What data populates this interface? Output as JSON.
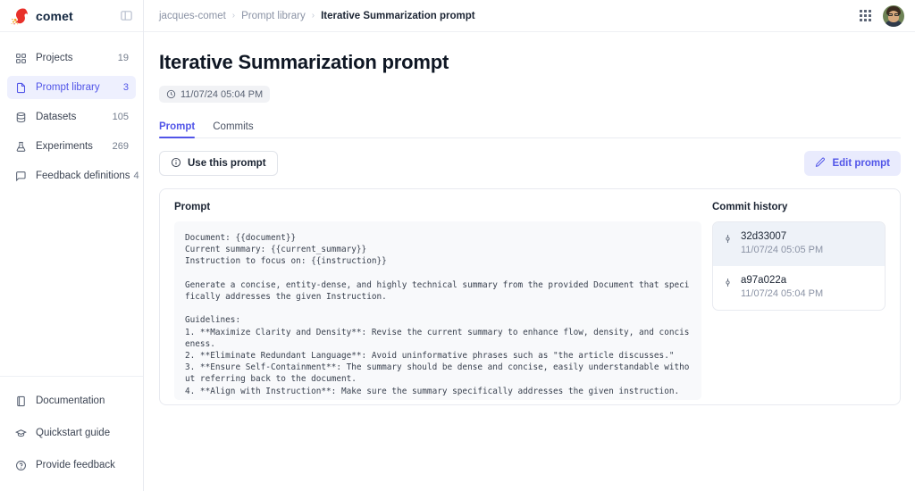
{
  "brand": {
    "name": "comet",
    "logo_icon": "comet-logo",
    "collapse_icon": "panel-collapse-icon"
  },
  "sidebar": {
    "items": [
      {
        "label": "Projects",
        "count": "19",
        "icon": "grid-icon",
        "active": false
      },
      {
        "label": "Prompt library",
        "count": "3",
        "icon": "document-icon",
        "active": true
      },
      {
        "label": "Datasets",
        "count": "105",
        "icon": "database-icon",
        "active": false
      },
      {
        "label": "Experiments",
        "count": "269",
        "icon": "flask-icon",
        "active": false
      },
      {
        "label": "Feedback definitions",
        "count": "4",
        "icon": "message-square-icon",
        "active": false
      }
    ],
    "footer_items": [
      {
        "label": "Documentation",
        "icon": "book-icon"
      },
      {
        "label": "Quickstart guide",
        "icon": "graduation-cap-icon"
      },
      {
        "label": "Provide feedback",
        "icon": "help-circle-icon"
      }
    ]
  },
  "topbar": {
    "breadcrumbs": [
      {
        "label": "jacques-comet",
        "current": false
      },
      {
        "label": "Prompt library",
        "current": false
      },
      {
        "label": "Iterative Summarization prompt",
        "current": true
      }
    ],
    "separator": "›",
    "apps_icon": "grid-apps-icon",
    "avatar": "user-avatar"
  },
  "page": {
    "title": "Iterative Summarization prompt",
    "timestamp": "11/07/24 05:04 PM",
    "clock_icon": "clock-icon",
    "tabs": [
      {
        "label": "Prompt",
        "active": true
      },
      {
        "label": "Commits",
        "active": false
      }
    ],
    "use_prompt_label": "Use this prompt",
    "use_prompt_icon": "info-circle-icon",
    "edit_prompt_label": "Edit prompt",
    "edit_prompt_icon": "pencil-icon"
  },
  "prompt_panel": {
    "label": "Prompt",
    "text": "Document: {{document}}\nCurrent summary: {{current_summary}}\nInstruction to focus on: {{instruction}}\n\nGenerate a concise, entity-dense, and highly technical summary from the provided Document that specifically addresses the given Instruction.\n\nGuidelines:\n1. **Maximize Clarity and Density**: Revise the current summary to enhance flow, density, and conciseness.\n2. **Eliminate Redundant Language**: Avoid uninformative phrases such as \"the article discusses.\"\n3. **Ensure Self-Containment**: The summary should be dense and concise, easily understandable without referring back to the document.\n4. **Align with Instruction**: Make sure the summary specifically addresses the given instruction."
  },
  "commit_history": {
    "label": "Commit history",
    "commit_icon": "git-commit-icon",
    "items": [
      {
        "hash": "32d33007",
        "date": "11/07/24 05:05 PM",
        "selected": true
      },
      {
        "hash": "a97a022a",
        "date": "11/07/24 05:04 PM",
        "selected": false
      }
    ]
  },
  "colors": {
    "accent": "#5155e8",
    "accent_soft_bg": "#e9ebfd",
    "nav_active_bg": "#eef0fe",
    "code_bg": "#f8f9fb",
    "commit_selected_bg": "#eef2f8",
    "border": "#e8eaf0",
    "brand_red": "#e8312a",
    "brand_orange": "#f5a623"
  }
}
